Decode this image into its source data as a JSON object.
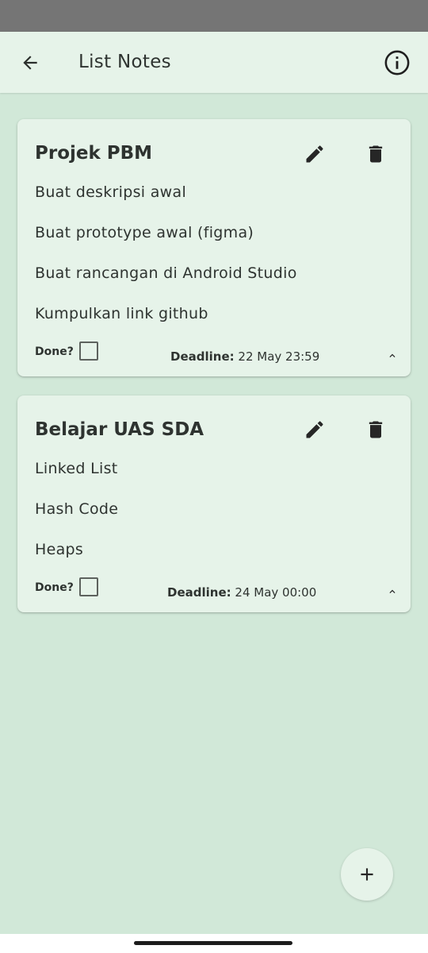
{
  "app_bar": {
    "title": "List Notes",
    "back_icon": "arrow-left-icon",
    "info_icon": "info-circle-icon"
  },
  "notes": [
    {
      "title": "Projek PBM",
      "items": [
        "Buat deskripsi awal",
        "Buat prototype awal (figma)",
        "Buat rancangan di Android Studio",
        "Kumpulkan link github"
      ],
      "done_label": "Done?",
      "done_checked": false,
      "deadline_label": "Deadline:",
      "deadline_value": "22 May 23:59",
      "expanded": true
    },
    {
      "title": "Belajar UAS SDA",
      "items": [
        "Linked List",
        "Hash Code",
        "Heaps"
      ],
      "done_label": "Done?",
      "done_checked": false,
      "deadline_label": "Deadline:",
      "deadline_value": "24 May 00:00",
      "expanded": true
    }
  ],
  "fab": {
    "icon": "plus-icon"
  },
  "colors": {
    "background": "#d1e8d8",
    "surface": "#e6f3e9",
    "text": "#2e3330",
    "status_bar": "#757575"
  }
}
